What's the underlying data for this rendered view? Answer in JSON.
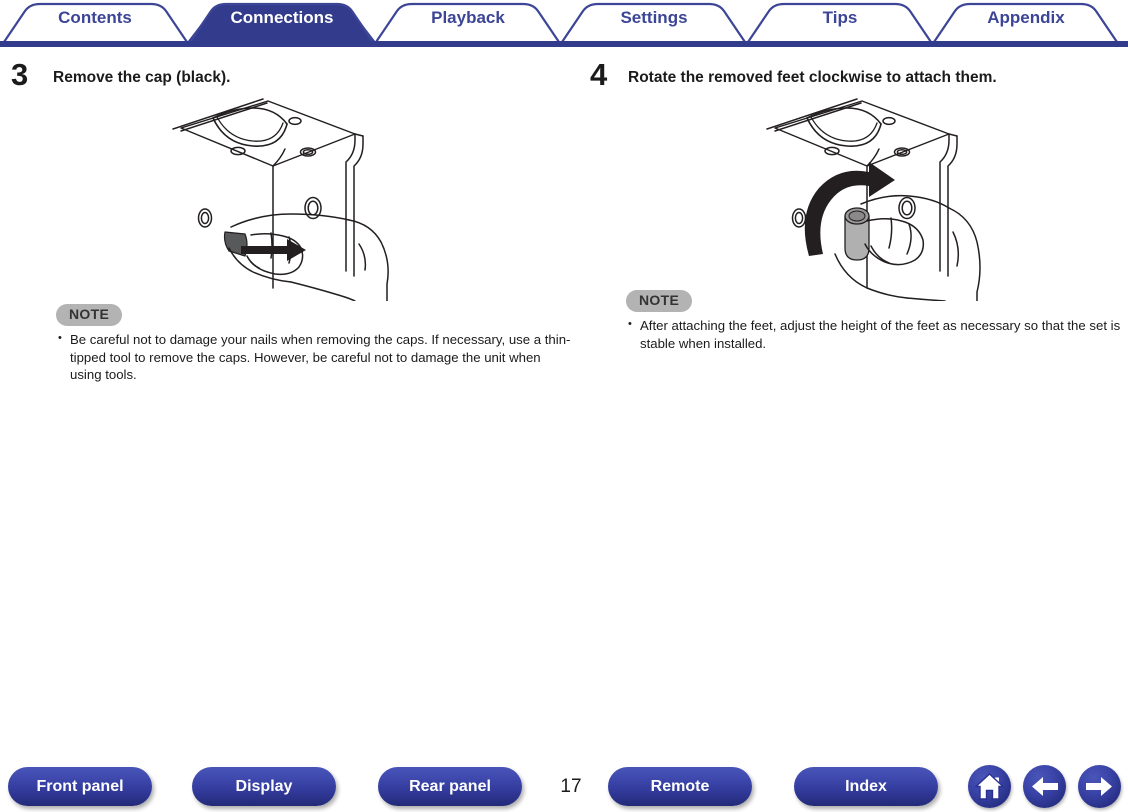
{
  "navtabs": {
    "items": [
      {
        "label": "Contents",
        "active": false
      },
      {
        "label": "Connections",
        "active": true
      },
      {
        "label": "Playback",
        "active": false
      },
      {
        "label": "Settings",
        "active": false
      },
      {
        "label": "Tips",
        "active": false
      },
      {
        "label": "Appendix",
        "active": false
      }
    ],
    "accent_color": "#3c4596",
    "active_bg_color": "#333c8c",
    "inactive_text_color": "#3c4596",
    "active_text_color": "#ffffff"
  },
  "steps": [
    {
      "number": "3",
      "title": "Remove the cap (black).",
      "figure": "hand-removing-cap-illustration",
      "note": {
        "badge": "NOTE",
        "items": [
          "Be careful not to damage your nails when removing the caps. If necessary, use a thin-tipped tool to remove the caps. However, be careful not to damage the unit when using tools."
        ]
      }
    },
    {
      "number": "4",
      "title": "Rotate the removed feet clockwise to attach them.",
      "figure": "hand-rotating-foot-illustration",
      "note": {
        "badge": "NOTE",
        "items": [
          "After attaching the feet, adjust the height of the feet as necessary so that the set is stable when installed."
        ]
      }
    }
  ],
  "footer": {
    "page_number": "17",
    "buttons": [
      {
        "label": "Front panel",
        "icon": "none"
      },
      {
        "label": "Display",
        "icon": "none"
      },
      {
        "label": "Rear panel",
        "icon": "none"
      },
      {
        "label": "Remote",
        "icon": "none"
      },
      {
        "label": "Index",
        "icon": "none"
      }
    ],
    "icon_buttons": [
      {
        "icon": "home-icon"
      },
      {
        "icon": "arrow-left-icon"
      },
      {
        "icon": "arrow-right-icon"
      }
    ],
    "button_color": "#313a9a"
  }
}
